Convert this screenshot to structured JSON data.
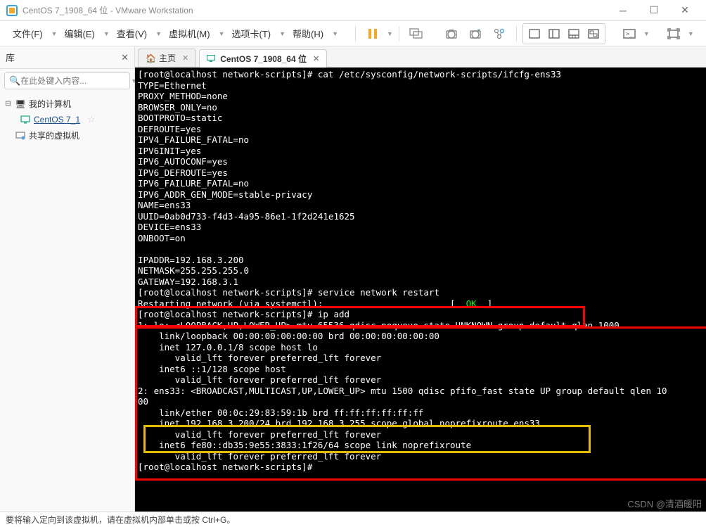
{
  "titlebar": {
    "title": "CentOS 7_1908_64 位 - VMware Workstation"
  },
  "menu": {
    "file": "文件(F)",
    "edit": "编辑(E)",
    "view": "查看(V)",
    "vm": "虚拟机(M)",
    "tabs": "选项卡(T)",
    "help": "帮助(H)"
  },
  "sidebar": {
    "header": "库",
    "search_placeholder": "在此处键入内容...",
    "nodes": {
      "mycomputer": "我的计算机",
      "centos": "CentOS 7_1",
      "shared": "共享的虚拟机"
    }
  },
  "tabs": {
    "home": "主页",
    "centos": "CentOS 7_1908_64 位"
  },
  "terminal": {
    "lines": [
      "[root@localhost network-scripts]# cat /etc/sysconfig/network-scripts/ifcfg-ens33",
      "TYPE=Ethernet",
      "PROXY_METHOD=none",
      "BROWSER_ONLY=no",
      "BOOTPROTO=static",
      "DEFROUTE=yes",
      "IPV4_FAILURE_FATAL=no",
      "IPV6INIT=yes",
      "IPV6_AUTOCONF=yes",
      "IPV6_DEFROUTE=yes",
      "IPV6_FAILURE_FATAL=no",
      "IPV6_ADDR_GEN_MODE=stable-privacy",
      "NAME=ens33",
      "UUID=0ab0d733-f4d3-4a95-86e1-1f2d241e1625",
      "DEVICE=ens33",
      "ONBOOT=on",
      "",
      "IPADDR=192.168.3.200",
      "NETMASK=255.255.255.0",
      "GATEWAY=192.168.3.1",
      "[root@localhost network-scripts]# service network restart",
      "Restarting network (via systemctl):                        [  ",
      "  ]",
      "[root@localhost network-scripts]# ip add",
      "1: lo: <LOOPBACK,UP,LOWER_UP> mtu 65536 qdisc noqueue state UNKNOWN group default qlen 1000",
      "    link/loopback 00:00:00:00:00:00 brd 00:00:00:00:00:00",
      "    inet 127.0.0.1/8 scope host lo",
      "       valid_lft forever preferred_lft forever",
      "    inet6 ::1/128 scope host",
      "       valid_lft forever preferred_lft forever",
      "2: ens33: <BROADCAST,MULTICAST,UP,LOWER_UP> mtu 1500 qdisc pfifo_fast state UP group default qlen 10",
      "00",
      "    link/ether 00:0c:29:83:59:1b brd ff:ff:ff:ff:ff:ff",
      "    inet 192.168.3.200/24 brd 192.168.3.255 scope global noprefixroute ens33",
      "       valid_lft forever preferred_lft forever",
      "    inet6 fe80::db35:9e55:3833:1f26/64 scope link noprefixroute",
      "       valid_lft forever preferred_lft forever",
      "[root@localhost network-scripts]# "
    ],
    "ok_text": "OK"
  },
  "statusbar": {
    "text": "要将输入定向到该虚拟机，请在虚拟机内部单击或按 Ctrl+G。"
  },
  "watermark": "CSDN @清酒暖阳"
}
